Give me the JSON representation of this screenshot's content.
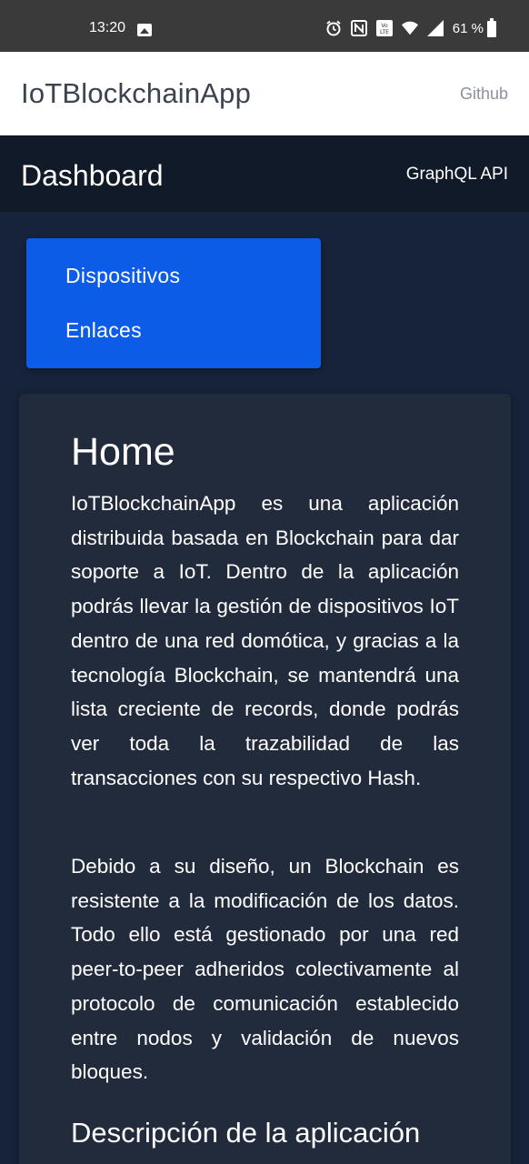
{
  "status_bar": {
    "time": "13:20",
    "battery": "61 %",
    "icons": [
      "image-icon",
      "alarm-icon",
      "nfc-icon",
      "volte-icon",
      "wifi-icon",
      "signal-icon",
      "battery-icon"
    ]
  },
  "header": {
    "brand": "IoTBlockchainApp",
    "github_link": "Github"
  },
  "subheader": {
    "title": "Dashboard",
    "api_link": "GraphQL API"
  },
  "menu": {
    "items": [
      {
        "label": "Dispositivos"
      },
      {
        "label": "Enlaces"
      }
    ]
  },
  "content": {
    "title": "Home",
    "paragraphs": [
      "IoTBlockchainApp es una aplicación distribuida basada en Blockchain para dar soporte a IoT. Dentro de la aplicación podrás llevar la gestión de dispositivos IoT dentro de una red domótica, y gracias a la tecnología Blockchain, se mantendrá una lista creciente de records, donde podrás ver toda la trazabilidad de las transacciones con su respectivo Hash.",
      "Debido a su diseño, un Blockchain es resistente a la modificación de los datos. Todo ello está gestionado por una red peer-to-peer adheridos colectivamente al protocolo de comunicación establecido entre nodos y validación de nuevos bloques."
    ],
    "section_heading": "Descripción de la aplicación"
  },
  "colors": {
    "page_bg": "#17233b",
    "menu_bg": "#0d5ce8",
    "card_bg": "#222b3c",
    "darkbar_bg": "#111a28"
  }
}
